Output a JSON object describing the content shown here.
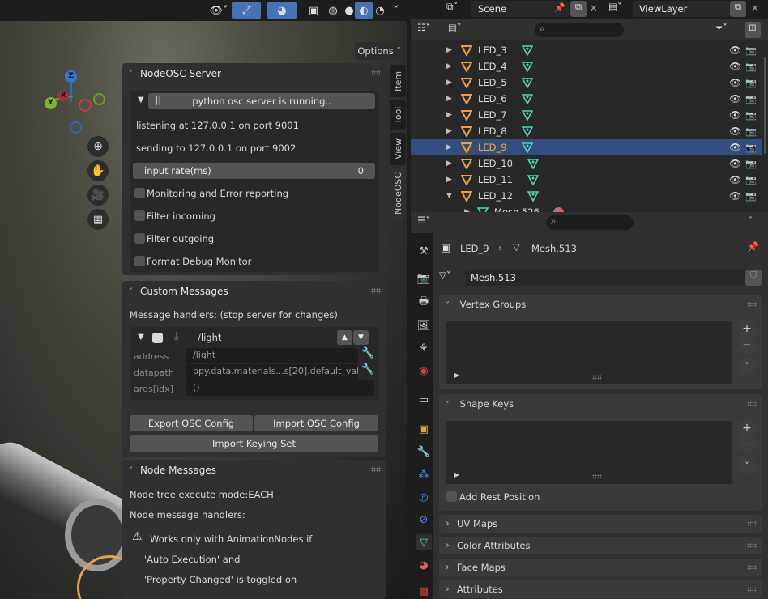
{
  "topbar": {
    "scene_label": "Scene",
    "viewlayer_label": "ViewLayer"
  },
  "viewport": {
    "options_label": "Options",
    "gizmo": {
      "x": "X",
      "y": "Y",
      "z": "Z"
    }
  },
  "side_tabs": [
    "Item",
    "Tool",
    "View",
    "NodeOSC"
  ],
  "nodeosc_server": {
    "title": "NodeOSC Server",
    "server_button": "python osc server is running..",
    "listening": "listening at 127.0.0.1 on port 9001",
    "sending": "sending to 127.0.0.1 on port 9002",
    "input_rate_label": "input rate(ms)",
    "input_rate_value": "0",
    "checkboxes": [
      "Monitoring and Error reporting",
      "Filter incoming",
      "Filter outgoing",
      "Format Debug Monitor"
    ]
  },
  "custom_messages": {
    "title": "Custom Messages",
    "handlers_label": "Message handlers: (stop server for changes)",
    "handler_name": "/light",
    "address_label": "address",
    "address_value": "/light",
    "datapath_label": "datapath",
    "datapath_value": "bpy.data.materials...s[20].default_value",
    "args_label": "args[idx]",
    "args_value": "()",
    "export_btn": "Export OSC Config",
    "import_btn": "Import OSC Config",
    "keying_btn": "Import Keying Set"
  },
  "node_messages": {
    "title": "Node Messages",
    "mode": "Node tree execute mode:EACH",
    "handlers": "Node message handlers:",
    "warn1": "Works only with AnimationNodes if",
    "warn2": "'Auto Execution' and",
    "warn3": "'Property Changed' is toggled on"
  },
  "outliner": {
    "rows": [
      {
        "label": "LED_3",
        "selected": false
      },
      {
        "label": "LED_4",
        "selected": false
      },
      {
        "label": "LED_5",
        "selected": false
      },
      {
        "label": "LED_6",
        "selected": false
      },
      {
        "label": "LED_7",
        "selected": false
      },
      {
        "label": "LED_8",
        "selected": false
      },
      {
        "label": "LED_9",
        "selected": true
      },
      {
        "label": "LED_10",
        "selected": false
      },
      {
        "label": "LED_11",
        "selected": false
      },
      {
        "label": "LED_12",
        "selected": false
      }
    ],
    "child": "Mesh.526"
  },
  "properties": {
    "breadcrumb_object": "LED_9",
    "breadcrumb_mesh": "Mesh.513",
    "mesh_name": "Mesh.513",
    "vertex_groups": "Vertex Groups",
    "shape_keys": "Shape Keys",
    "add_rest_position": "Add Rest Position",
    "uv_maps": "UV Maps",
    "color_attributes": "Color Attributes",
    "face_maps": "Face Maps",
    "attributes": "Attributes"
  },
  "colors": {
    "accent_orange": "#e8a34a",
    "mesh_green": "#4fd7b3",
    "selected_row": "#334d80",
    "selected_text": "#ffaf29"
  }
}
